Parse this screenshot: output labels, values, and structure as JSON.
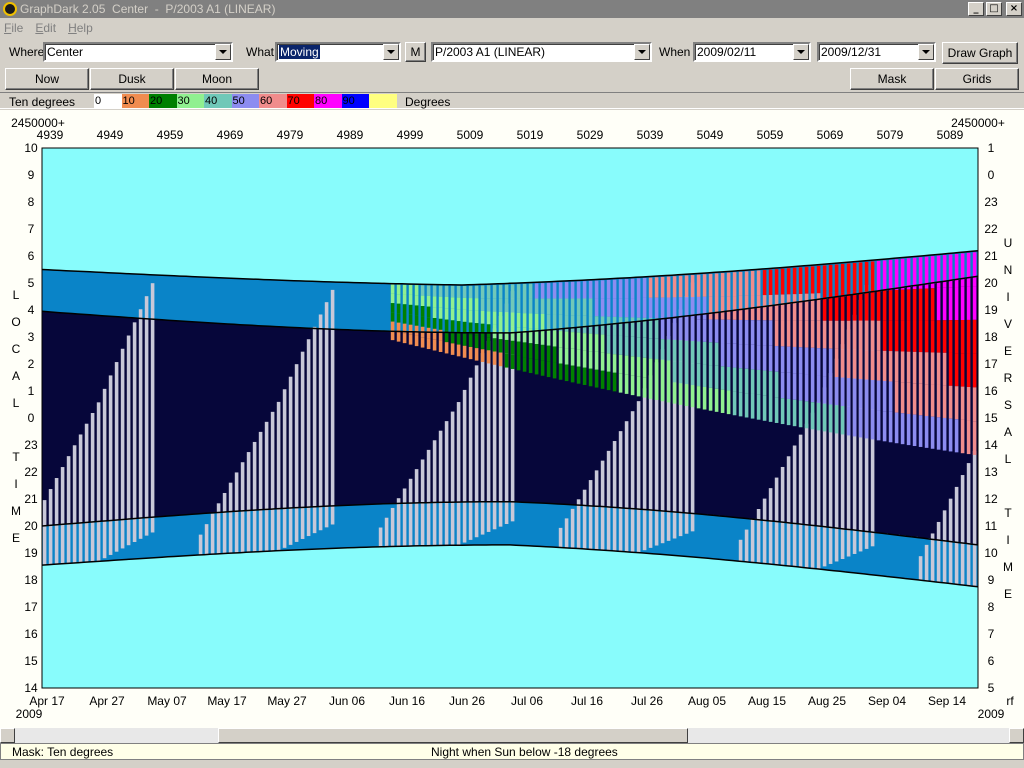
{
  "window": {
    "title": "GraphDark 2.05  Center  -  P/2003 A1 (LINEAR)",
    "buttons": [
      "_",
      "□",
      "×"
    ]
  },
  "menu": [
    {
      "label": "File"
    },
    {
      "label": "Edit"
    },
    {
      "label": "Help"
    }
  ],
  "toolbar": {
    "where_label": "Where",
    "where_value": "Center",
    "what_label": "What",
    "what_value": "Moving",
    "m_button": "M",
    "object_value": "P/2003 A1 (LINEAR)",
    "when_label": "When",
    "start_date": "2009/02/11",
    "end_date": "2009/12/31",
    "draw_button": "Draw Graph"
  },
  "buttons": {
    "now": "Now",
    "dusk": "Dusk",
    "moon": "Moon",
    "mask": "Mask",
    "grids": "Grids"
  },
  "legend": {
    "title": "Ten degrees",
    "unit": "Degrees",
    "items": [
      {
        "label": "0",
        "color": "#ffffff"
      },
      {
        "label": "10",
        "color": "#f08c50"
      },
      {
        "label": "20",
        "color": "#008000"
      },
      {
        "label": "30",
        "color": "#90f090"
      },
      {
        "label": "40",
        "color": "#70c8b8"
      },
      {
        "label": "50",
        "color": "#8c8cf0"
      },
      {
        "label": "60",
        "color": "#f08c8c"
      },
      {
        "label": "70",
        "color": "#ff0000"
      },
      {
        "label": "80",
        "color": "#ff00ff"
      },
      {
        "label": "90",
        "color": "#0000ff"
      },
      {
        "label": "",
        "color": "#ffff80"
      }
    ]
  },
  "graph": {
    "jd_prefix_left": "2450000+",
    "jd_prefix_right": "2450000+",
    "jd_ticks": [
      "4939",
      "4949",
      "4959",
      "4969",
      "4979",
      "4989",
      "4999",
      "5009",
      "5019",
      "5029",
      "5039",
      "5049",
      "5059",
      "5069",
      "5079",
      "5089"
    ],
    "local_time_ticks": [
      "10",
      "9",
      "8",
      "7",
      "6",
      "5",
      "4",
      "3",
      "2",
      "1",
      "0",
      "23",
      "22",
      "21",
      "20",
      "19",
      "18",
      "17",
      "16",
      "15",
      "14"
    ],
    "universal_time_ticks": [
      "1",
      "0",
      "23",
      "22",
      "21",
      "20",
      "19",
      "18",
      "17",
      "16",
      "15",
      "14",
      "13",
      "12",
      "11",
      "10",
      "9",
      "8",
      "7",
      "6",
      "5"
    ],
    "date_ticks": [
      "Apr 17",
      "Apr 27",
      "May 07",
      "May 17",
      "May 27",
      "Jun 06",
      "Jun 16",
      "Jun 26",
      "Jul 06",
      "Jul 16",
      "Jul 26",
      "Aug 05",
      "Aug 15",
      "Aug 25",
      "Sep 04",
      "Sep 14"
    ],
    "year_left": "2009",
    "year_right": "2009",
    "corner_right": "rf",
    "left_axis_title": [
      "L",
      "O",
      "C",
      "A",
      "L",
      "",
      "T",
      "I",
      "M",
      "E"
    ],
    "right_axis_title": [
      "U",
      "N",
      "I",
      "V",
      "E",
      "R",
      "S",
      "A",
      "L",
      "",
      "T",
      "I",
      "M",
      "E"
    ],
    "colors": {
      "day": "#88fcfc",
      "twilight": "#0a84c8",
      "night": "#06063a",
      "moonlit": "#c8c8d8"
    }
  },
  "status": {
    "mask": "Mask:  Ten degrees",
    "message": "Night when Sun below -18 degrees"
  }
}
